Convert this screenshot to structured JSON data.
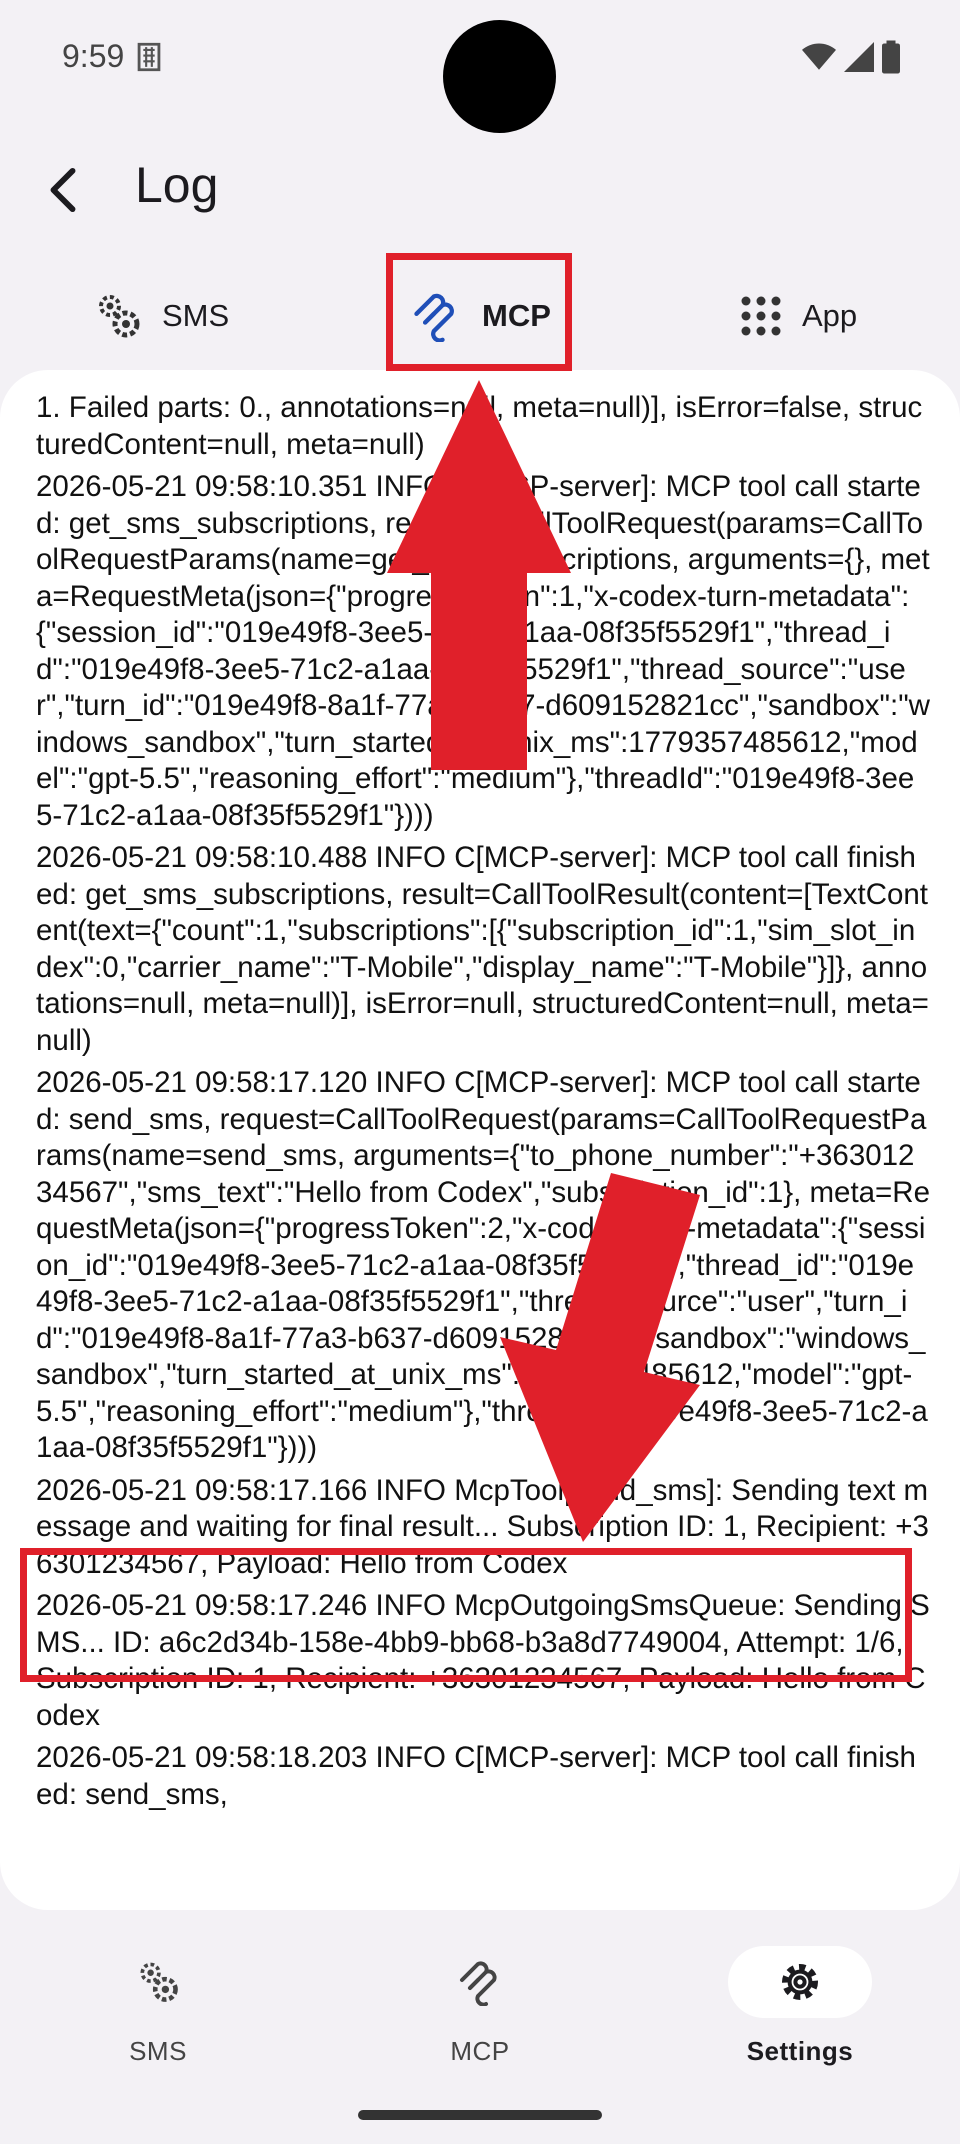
{
  "status_bar": {
    "time": "9:59",
    "sim_icon": "sim-card-icon",
    "wifi_icon": "wifi-icon",
    "signal_icon": "cell-signal-icon",
    "battery_icon": "battery-icon"
  },
  "header": {
    "title": "Log",
    "back_icon": "arrow-back-icon"
  },
  "tabs": [
    {
      "label": "SMS",
      "icon": "gears-icon",
      "active": false
    },
    {
      "label": "MCP",
      "icon": "mcp-icon",
      "active": true
    },
    {
      "label": "App",
      "icon": "apps-grid-icon",
      "active": false
    }
  ],
  "log": {
    "entries": [
      "1. Failed parts: 0., annotations=null, meta=null)], isError=false, structuredContent=null, meta=null)",
      "2026-05-21 09:58:10.351 INFO C[MCP-server]: MCP tool call started: get_sms_subscriptions, request=CallToolRequest(params=CallToolRequestParams(name=get_sms_subscriptions, arguments={}, meta=RequestMeta(json={\"progressToken\":1,\"x-codex-turn-metadata\":{\"session_id\":\"019e49f8-3ee5-71c2-a1aa-08f35f5529f1\",\"thread_id\":\"019e49f8-3ee5-71c2-a1aa-08f35f5529f1\",\"thread_source\":\"user\",\"turn_id\":\"019e49f8-8a1f-77a3-b637-d609152821cc\",\"sandbox\":\"windows_sandbox\",\"turn_started_at_unix_ms\":1779357485612,\"model\":\"gpt-5.5\",\"reasoning_effort\":\"medium\"},\"threadId\":\"019e49f8-3ee5-71c2-a1aa-08f35f5529f1\"})))",
      "2026-05-21 09:58:10.488 INFO C[MCP-server]: MCP tool call finished: get_sms_subscriptions, result=CallToolResult(content=[TextContent(text={\"count\":1,\"subscriptions\":[{\"subscription_id\":1,\"sim_slot_index\":0,\"carrier_name\":\"T-Mobile\",\"display_name\":\"T-Mobile\"}]}, annotations=null, meta=null)], isError=null, structuredContent=null, meta=null)",
      "2026-05-21 09:58:17.120 INFO C[MCP-server]: MCP tool call started: send_sms, request=CallToolRequest(params=CallToolRequestParams(name=send_sms, arguments={\"to_phone_number\":\"+36301234567\",\"sms_text\":\"Hello from Codex\",\"subscription_id\":1}, meta=RequestMeta(json={\"progressToken\":2,\"x-codex-turn-metadata\":{\"session_id\":\"019e49f8-3ee5-71c2-a1aa-08f35f5529f1\",\"thread_id\":\"019e49f8-3ee5-71c2-a1aa-08f35f5529f1\",\"thread_source\":\"user\",\"turn_id\":\"019e49f8-8a1f-77a3-b637-d609152821cc\",\"sandbox\":\"windows_sandbox\",\"turn_started_at_unix_ms\":1779357485612,\"model\":\"gpt-5.5\",\"reasoning_effort\":\"medium\"},\"threadId\":\"019e49f8-3ee5-71c2-a1aa-08f35f5529f1\"})))",
      "2026-05-21 09:58:17.166 INFO McpTool[send_sms]: Sending text message and waiting for final result... Subscription ID: 1, Recipient: +36301234567, Payload: Hello from Codex",
      "2026-05-21 09:58:17.246 INFO McpOutgoingSmsQueue: Sending SMS... ID: a6c2d34b-158e-4bb9-bb68-b3a8d7749004, Attempt: 1/6, Subscription ID: 1, Recipient: +36301234567, Payload: Hello from Codex",
      "2026-05-21 09:58:18.203 INFO C[MCP-server]: MCP tool call finished: send_sms,"
    ]
  },
  "bottom_nav": [
    {
      "label": "SMS",
      "icon": "gears-icon",
      "active": false
    },
    {
      "label": "MCP",
      "icon": "mcp-icon",
      "active": false
    },
    {
      "label": "Settings",
      "icon": "settings-icon",
      "active": true
    }
  ],
  "annotation_color": "#e0202a"
}
